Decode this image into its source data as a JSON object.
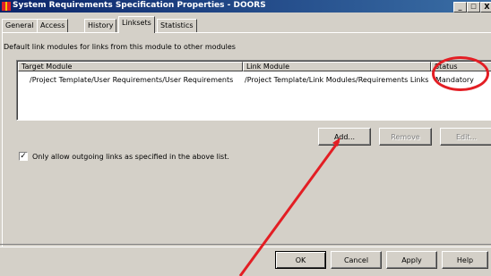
{
  "window": {
    "title": "System Requirements Specification Properties - DOORS",
    "controls": [
      "_",
      "□",
      "X"
    ]
  },
  "tabs": [
    {
      "label": "General",
      "active": false
    },
    {
      "label": "Access",
      "active": false
    },
    {
      "label": "History",
      "active": false
    },
    {
      "label": "Linksets",
      "active": true
    },
    {
      "label": "Statistics",
      "active": false
    }
  ],
  "linksets": {
    "description": "Default link modules for links from this module to other modules",
    "columns": {
      "target": "Target Module",
      "link": "Link Module",
      "status": "Status"
    },
    "rows": [
      {
        "target": "/Project Template/User Requirements/User Requirements",
        "link": "/Project Template/Link Modules/Requirements Links",
        "status": "Mandatory"
      }
    ],
    "buttons": {
      "add": "Add...",
      "remove": "Remove",
      "edit": "Edit..."
    },
    "checkbox": {
      "label": "Only allow outgoing links as specified in the above list.",
      "checked": true
    }
  },
  "footer": {
    "ok": "OK",
    "cancel": "Cancel",
    "apply": "Apply",
    "help": "Help"
  },
  "annotation_color": "#e31e24"
}
